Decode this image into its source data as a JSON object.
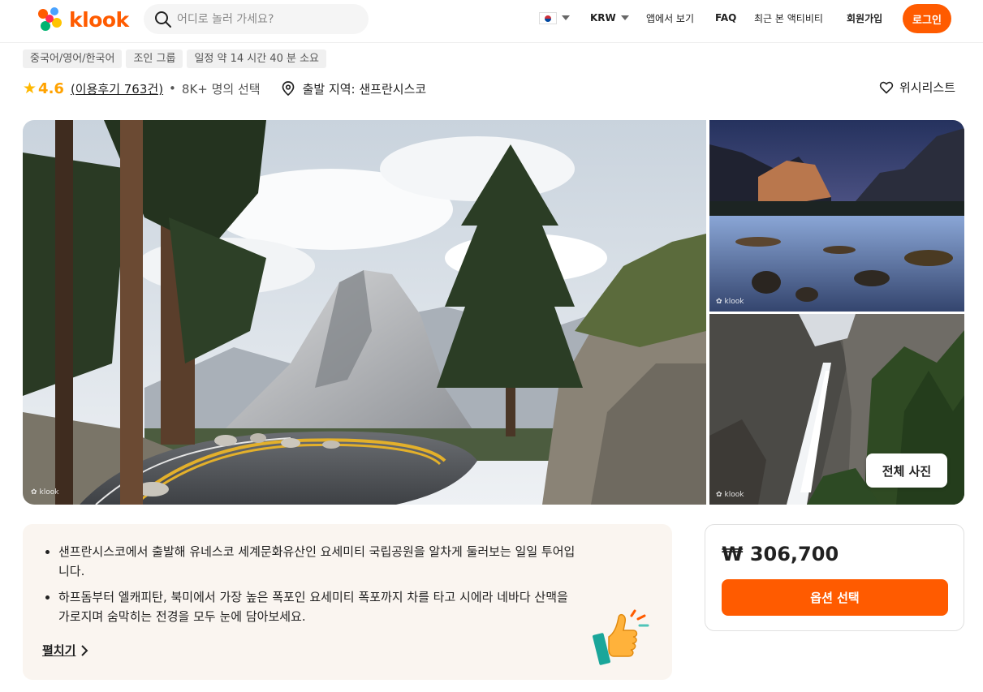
{
  "header": {
    "logo_text": "klook",
    "search_placeholder": "어디로 놀러 가세요?",
    "currency": "KRW",
    "app_link": "앱에서 보기",
    "faq": "FAQ",
    "recent": "최근 본 액티비티",
    "signup": "회원가입",
    "login": "로그인",
    "brand_color": "#ff5b00"
  },
  "tags": [
    "중국어/영어/한국어",
    "조인 그룹",
    "일정 약 14 시간 40 분 소요"
  ],
  "rating": {
    "score": "4.6",
    "reviews": "(이용후기 763건)",
    "booked": "8K+ 명의 선택",
    "departure": "출발 지역: 샌프란시스코",
    "wishlist": "위시리스트"
  },
  "gallery": {
    "watermark": "klook",
    "all_photos": "전체 사진"
  },
  "highlights": {
    "items": [
      "샌프란시스코에서 출발해 유네스코 세계문화유산인 요세미티 국립공원을 알차게 둘러보는 일일 투어입니다.",
      "하프돔부터 엘캐피탄, 북미에서 가장 높은 폭포인 요세미티 폭포까지 차를 타고 시에라 네바다 산맥을 가로지며 숨막히는 전경을 모두 눈에 담아보세요."
    ],
    "expand": "펼치기"
  },
  "price": {
    "amount": "₩ 306,700",
    "option_button": "옵션 선택"
  }
}
